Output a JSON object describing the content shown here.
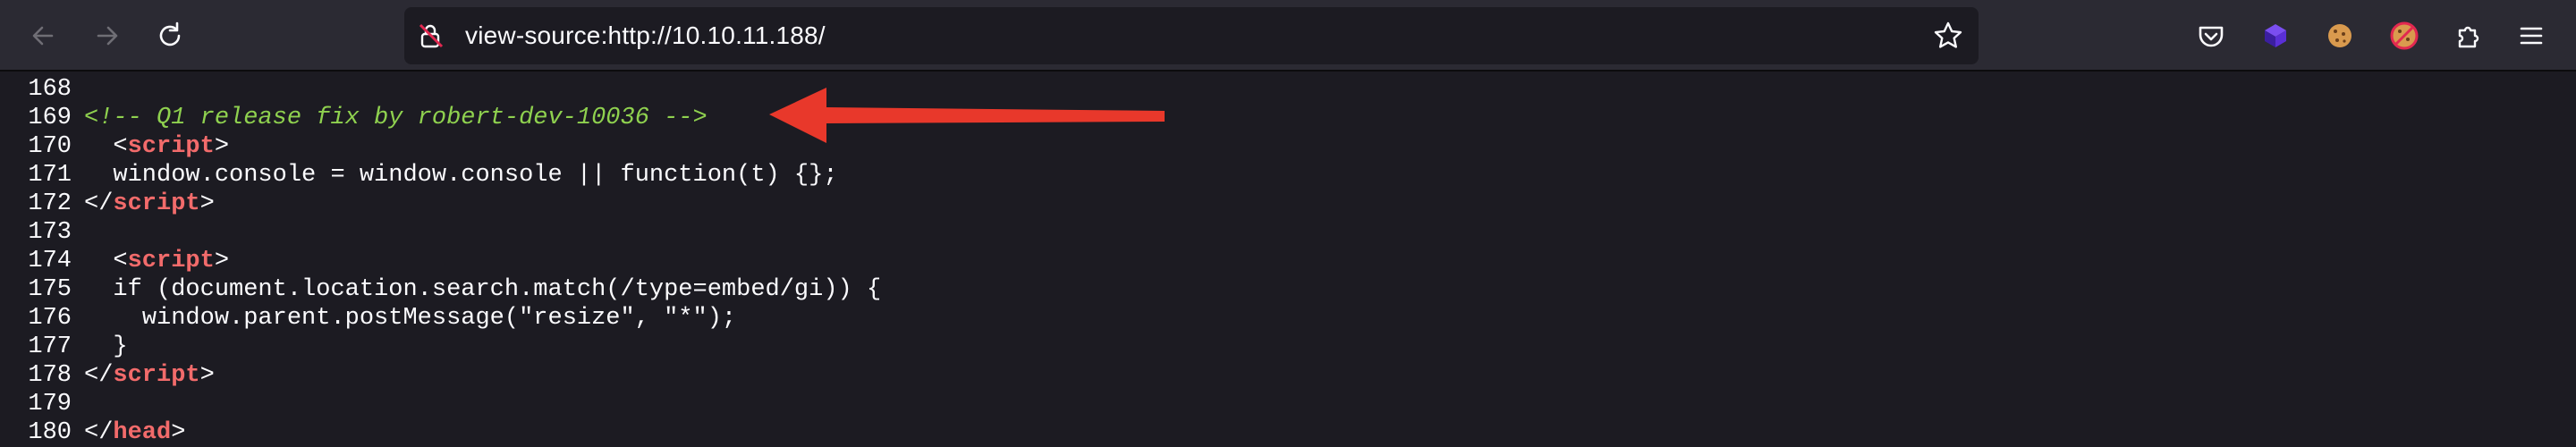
{
  "browser": {
    "url": "view-source:http://10.10.11.188/",
    "icons": [
      "back-icon",
      "forward-icon",
      "reload-icon",
      "security-icon",
      "bookmark-star-icon",
      "pocket-icon",
      "extension-cube-icon",
      "cookie-icon",
      "no-cookie-icon",
      "extensions-puzzle-icon",
      "menu-icon"
    ],
    "accent": "#fbfbfe"
  },
  "source": {
    "lines": [
      {
        "n": "168",
        "indent": "",
        "parts": []
      },
      {
        "n": "169",
        "indent": "",
        "comment": "<!-- Q1 release fix by robert-dev-10036 -->"
      },
      {
        "n": "170",
        "indent": "  ",
        "open": "<",
        "tag": "script",
        "close": ">"
      },
      {
        "n": "171",
        "indent": "  ",
        "text": "window.console = window.console || function(t) {};"
      },
      {
        "n": "172",
        "indent": "",
        "open": "</",
        "tag": "script",
        "close": ">"
      },
      {
        "n": "173",
        "indent": "",
        "text": ""
      },
      {
        "n": "174",
        "indent": "  ",
        "open": "<",
        "tag": "script",
        "close": ">"
      },
      {
        "n": "175",
        "indent": "  ",
        "text": "if (document.location.search.match(/type=embed/gi)) {"
      },
      {
        "n": "176",
        "indent": "    ",
        "text": "window.parent.postMessage(\"resize\", \"*\");"
      },
      {
        "n": "177",
        "indent": "  ",
        "text": "}"
      },
      {
        "n": "178",
        "indent": "",
        "open": "</",
        "tag": "script",
        "close": ">"
      },
      {
        "n": "179",
        "indent": "",
        "text": ""
      },
      {
        "n": "180",
        "indent": "",
        "open": "</",
        "tag": "head",
        "close": ">"
      }
    ],
    "colors": {
      "comment": "#8fd14f",
      "tag": "#f26b6b",
      "text": "#fbfbfe"
    }
  },
  "annotation": {
    "arrow_color": "#e8382b"
  }
}
